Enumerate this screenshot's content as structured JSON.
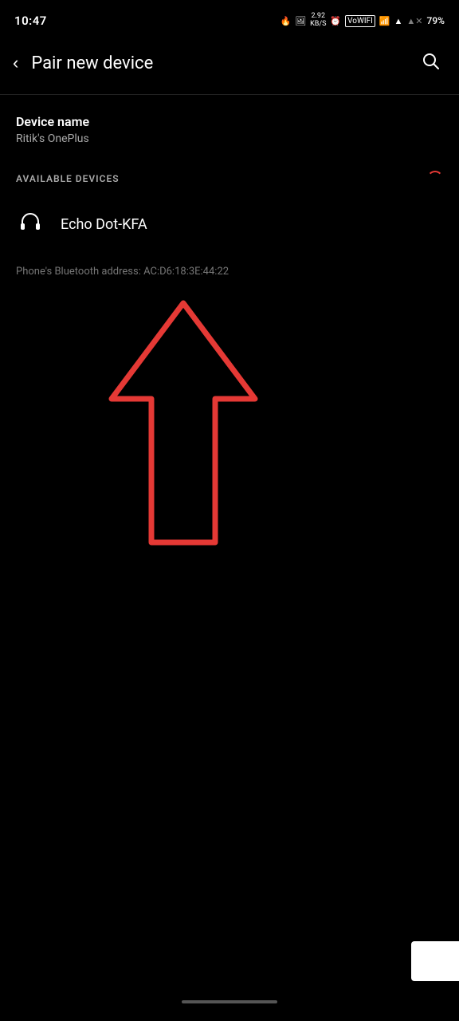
{
  "statusBar": {
    "time": "10:47",
    "data_speed": "2.92",
    "data_unit": "KB/S",
    "battery": "79%",
    "icons": {
      "drop": "💧",
      "image": "🖼",
      "alarm": "⏰",
      "wifi": "WiFi",
      "signal": "▲",
      "battery_icon": "🔋"
    }
  },
  "appBar": {
    "title": "Pair new device",
    "back_label": "<",
    "search_icon": "search"
  },
  "deviceName": {
    "label": "Device name",
    "value": "Ritik's OnePlus"
  },
  "availableDevices": {
    "section_label": "AVAILABLE DEVICES",
    "devices": [
      {
        "name": "Echo Dot-KFA",
        "icon": "headphones"
      }
    ]
  },
  "bluetoothAddress": {
    "text": "Phone's Bluetooth address: AC:D6:18:3E:44:22"
  }
}
